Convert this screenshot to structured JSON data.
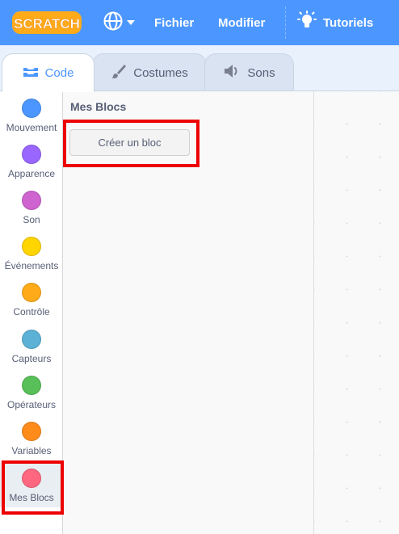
{
  "menubar": {
    "logo_text": "SCRATCH",
    "file_label": "Fichier",
    "edit_label": "Modifier",
    "tutorials_label": "Tutoriels"
  },
  "tabs": [
    {
      "label": "Code",
      "icon": "code-icon",
      "active": true
    },
    {
      "label": "Costumes",
      "icon": "brush-icon",
      "active": false
    },
    {
      "label": "Sons",
      "icon": "speaker-icon",
      "active": false
    }
  ],
  "categories": [
    {
      "label": "Mouvement",
      "color": "#4c97ff"
    },
    {
      "label": "Apparence",
      "color": "#9966ff"
    },
    {
      "label": "Son",
      "color": "#cf63cf"
    },
    {
      "label": "Événements",
      "color": "#ffd500"
    },
    {
      "label": "Contrôle",
      "color": "#ffab19"
    },
    {
      "label": "Capteurs",
      "color": "#5cb1d6"
    },
    {
      "label": "Opérateurs",
      "color": "#59c059"
    },
    {
      "label": "Variables",
      "color": "#ff8c1a"
    },
    {
      "label": "Mes Blocs",
      "color": "#ff6680",
      "selected": true
    }
  ],
  "flyout": {
    "title": "Mes Blocs",
    "make_block_label": "Créer un bloc"
  },
  "colors": {
    "menubar": "#4c97ff",
    "highlight": "#ec0000"
  }
}
